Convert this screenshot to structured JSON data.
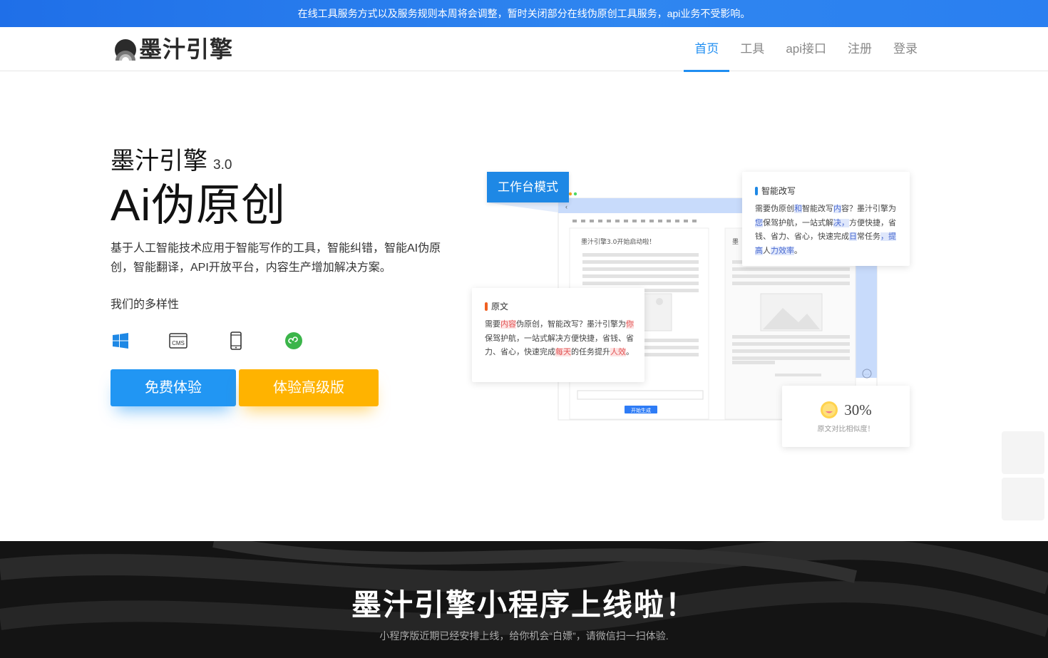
{
  "announcement": "在线工具服务方式以及服务规则本周将会调整，暂时关闭部分在线伪原创工具服务，api业务不受影响。",
  "logo": {
    "text": "墨汁引擎"
  },
  "nav": {
    "items": [
      {
        "label": "首页"
      },
      {
        "label": "工具"
      },
      {
        "label": "api接口"
      },
      {
        "label": "注册"
      },
      {
        "label": "登录"
      }
    ]
  },
  "hero": {
    "brand": "墨汁引擎",
    "version": "3.0",
    "title": "Ai伪原创",
    "description": "基于人工智能技术应用于智能写作的工具，智能纠错，智能AI伪原创，智能翻译，API开放平台，内容生产增加解决方案。",
    "diversity_label": "我们的多样性",
    "platforms": [
      {
        "icon": "windows-icon"
      },
      {
        "icon": "cms-icon",
        "text": "CMS"
      },
      {
        "icon": "mobile-icon"
      },
      {
        "icon": "mini-program-icon"
      }
    ],
    "btn_free": "免费体验",
    "btn_pro": "体验高级版"
  },
  "illustration": {
    "workspace_tag": "工作台模式",
    "editor_text": "墨汁引擎3.0开始启动啦！",
    "editor_text_right": "墨",
    "generate_btn": "开始生成",
    "rewrite_card": {
      "title": "智能改写",
      "segments": [
        {
          "t": "需要伪原创",
          "h": ""
        },
        {
          "t": "和",
          "h": "b"
        },
        {
          "t": "智能改写",
          "h": ""
        },
        {
          "t": "内",
          "h": "b"
        },
        {
          "t": "容？墨汁引擎为",
          "h": ""
        },
        {
          "t": "您",
          "h": "b"
        },
        {
          "t": "保驾护航，一站式解",
          "h": ""
        },
        {
          "t": "决，",
          "h": "b"
        },
        {
          "t": "方便快捷，省钱、省力、省心，快速完成",
          "h": ""
        },
        {
          "t": "日",
          "h": "b"
        },
        {
          "t": "常任务",
          "h": ""
        },
        {
          "t": "，提高",
          "h": "b"
        },
        {
          "t": "人",
          "h": ""
        },
        {
          "t": "力",
          "h": "b"
        },
        {
          "t": "效率",
          "h": "b"
        },
        {
          "t": "。",
          "h": ""
        }
      ]
    },
    "original_card": {
      "title": "原文",
      "segments": [
        {
          "t": "需要",
          "h": ""
        },
        {
          "t": "内容",
          "h": "r"
        },
        {
          "t": "伪原创，智能改写？墨汁引擎为",
          "h": ""
        },
        {
          "t": "你",
          "h": "r"
        },
        {
          "t": "保驾护航，一站式解决方便快捷，省钱、省力、省心，快速完成",
          "h": ""
        },
        {
          "t": "每天",
          "h": "r"
        },
        {
          "t": "的任务提升",
          "h": ""
        },
        {
          "t": "人效",
          "h": "r"
        },
        {
          "t": "。",
          "h": ""
        }
      ]
    },
    "similarity": {
      "value": "30%",
      "label": "原文对比相似度！"
    }
  },
  "promo": {
    "title": "墨汁引擎小程序上线啦！",
    "subtitle": "小程序版近期已经安排上线，给你机会“白嫖”，请微信扫一扫体验."
  },
  "colors": {
    "primary": "#1f8ef1",
    "btn_free": "#2196f3",
    "btn_pro": "#ffb300",
    "banner": "#2a7ff0"
  }
}
